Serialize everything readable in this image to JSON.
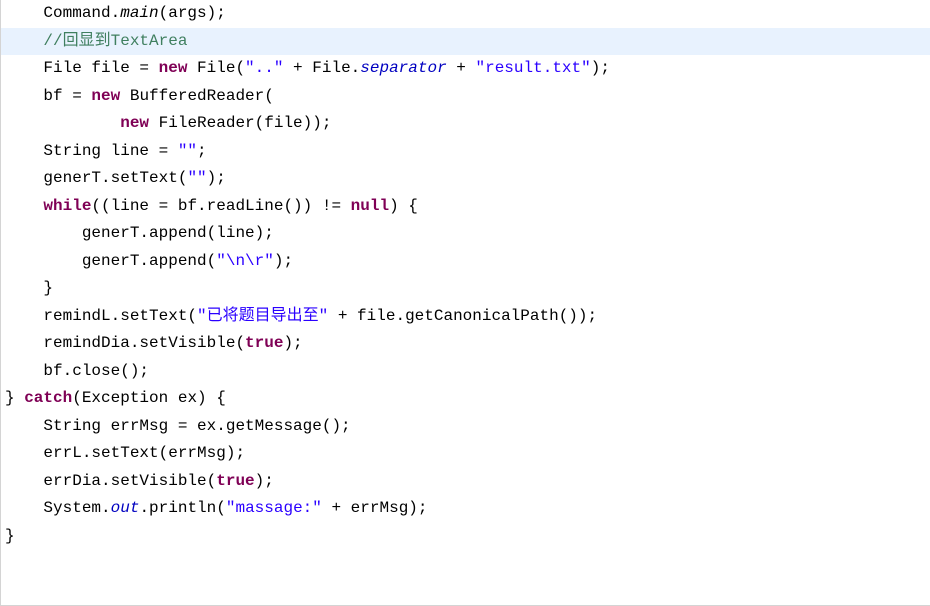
{
  "code": {
    "lines": [
      {
        "indent": "    ",
        "tokens": [
          {
            "t": "Command.",
            "c": "plain"
          },
          {
            "t": "main",
            "c": "static-method"
          },
          {
            "t": "(args);",
            "c": "plain"
          }
        ]
      },
      {
        "indent": "    ",
        "highlight": true,
        "tokens": [
          {
            "t": "//回显到TextArea",
            "c": "com"
          }
        ]
      },
      {
        "indent": "    ",
        "tokens": [
          {
            "t": "File file = ",
            "c": "plain"
          },
          {
            "t": "new",
            "c": "kw"
          },
          {
            "t": " File(",
            "c": "plain"
          },
          {
            "t": "\"..\"",
            "c": "str"
          },
          {
            "t": " + File.",
            "c": "plain"
          },
          {
            "t": "separator",
            "c": "static-field"
          },
          {
            "t": " + ",
            "c": "plain"
          },
          {
            "t": "\"result.txt\"",
            "c": "str"
          },
          {
            "t": ");",
            "c": "plain"
          }
        ]
      },
      {
        "indent": "    ",
        "tokens": [
          {
            "t": "bf = ",
            "c": "plain"
          },
          {
            "t": "new",
            "c": "kw"
          },
          {
            "t": " BufferedReader(",
            "c": "plain"
          }
        ]
      },
      {
        "indent": "            ",
        "tokens": [
          {
            "t": "new",
            "c": "kw"
          },
          {
            "t": " FileReader(file));",
            "c": "plain"
          }
        ]
      },
      {
        "indent": "    ",
        "tokens": [
          {
            "t": "String line = ",
            "c": "plain"
          },
          {
            "t": "\"\"",
            "c": "str"
          },
          {
            "t": ";",
            "c": "plain"
          }
        ]
      },
      {
        "indent": "    ",
        "tokens": [
          {
            "t": "generT.setText(",
            "c": "plain"
          },
          {
            "t": "\"\"",
            "c": "str"
          },
          {
            "t": ");",
            "c": "plain"
          }
        ]
      },
      {
        "indent": "    ",
        "tokens": [
          {
            "t": "while",
            "c": "kw"
          },
          {
            "t": "((line = bf.readLine()) != ",
            "c": "plain"
          },
          {
            "t": "null",
            "c": "kw"
          },
          {
            "t": ") {",
            "c": "plain"
          }
        ]
      },
      {
        "indent": "        ",
        "tokens": [
          {
            "t": "generT.append(line);",
            "c": "plain"
          }
        ]
      },
      {
        "indent": "        ",
        "tokens": [
          {
            "t": "generT.append(",
            "c": "plain"
          },
          {
            "t": "\"\\n\\r\"",
            "c": "str"
          },
          {
            "t": ");",
            "c": "plain"
          }
        ]
      },
      {
        "indent": "    ",
        "tokens": [
          {
            "t": "}",
            "c": "plain"
          }
        ]
      },
      {
        "indent": "    ",
        "tokens": [
          {
            "t": "remindL.setText(",
            "c": "plain"
          },
          {
            "t": "\"已将题目导出至\"",
            "c": "str"
          },
          {
            "t": " + file.getCanonicalPath());",
            "c": "plain"
          }
        ]
      },
      {
        "indent": "    ",
        "tokens": [
          {
            "t": "remindDia.setVisible(",
            "c": "plain"
          },
          {
            "t": "true",
            "c": "kw"
          },
          {
            "t": ");",
            "c": "plain"
          }
        ]
      },
      {
        "indent": "    ",
        "tokens": [
          {
            "t": "bf.close();",
            "c": "plain"
          }
        ]
      },
      {
        "indent": "",
        "tokens": [
          {
            "t": "} ",
            "c": "plain"
          },
          {
            "t": "catch",
            "c": "kw"
          },
          {
            "t": "(Exception ex) {",
            "c": "plain"
          }
        ]
      },
      {
        "indent": "    ",
        "tokens": [
          {
            "t": "String errMsg = ex.getMessage();",
            "c": "plain"
          }
        ]
      },
      {
        "indent": "    ",
        "tokens": [
          {
            "t": "errL.setText(errMsg);",
            "c": "plain"
          }
        ]
      },
      {
        "indent": "    ",
        "tokens": [
          {
            "t": "errDia.setVisible(",
            "c": "plain"
          },
          {
            "t": "true",
            "c": "kw"
          },
          {
            "t": ");",
            "c": "plain"
          }
        ]
      },
      {
        "indent": "    ",
        "tokens": [
          {
            "t": "System.",
            "c": "plain"
          },
          {
            "t": "out",
            "c": "static-field"
          },
          {
            "t": ".println(",
            "c": "plain"
          },
          {
            "t": "\"massage:\"",
            "c": "str"
          },
          {
            "t": " + errMsg);",
            "c": "plain"
          }
        ]
      },
      {
        "indent": "",
        "tokens": [
          {
            "t": "}",
            "c": "plain"
          }
        ]
      }
    ]
  }
}
